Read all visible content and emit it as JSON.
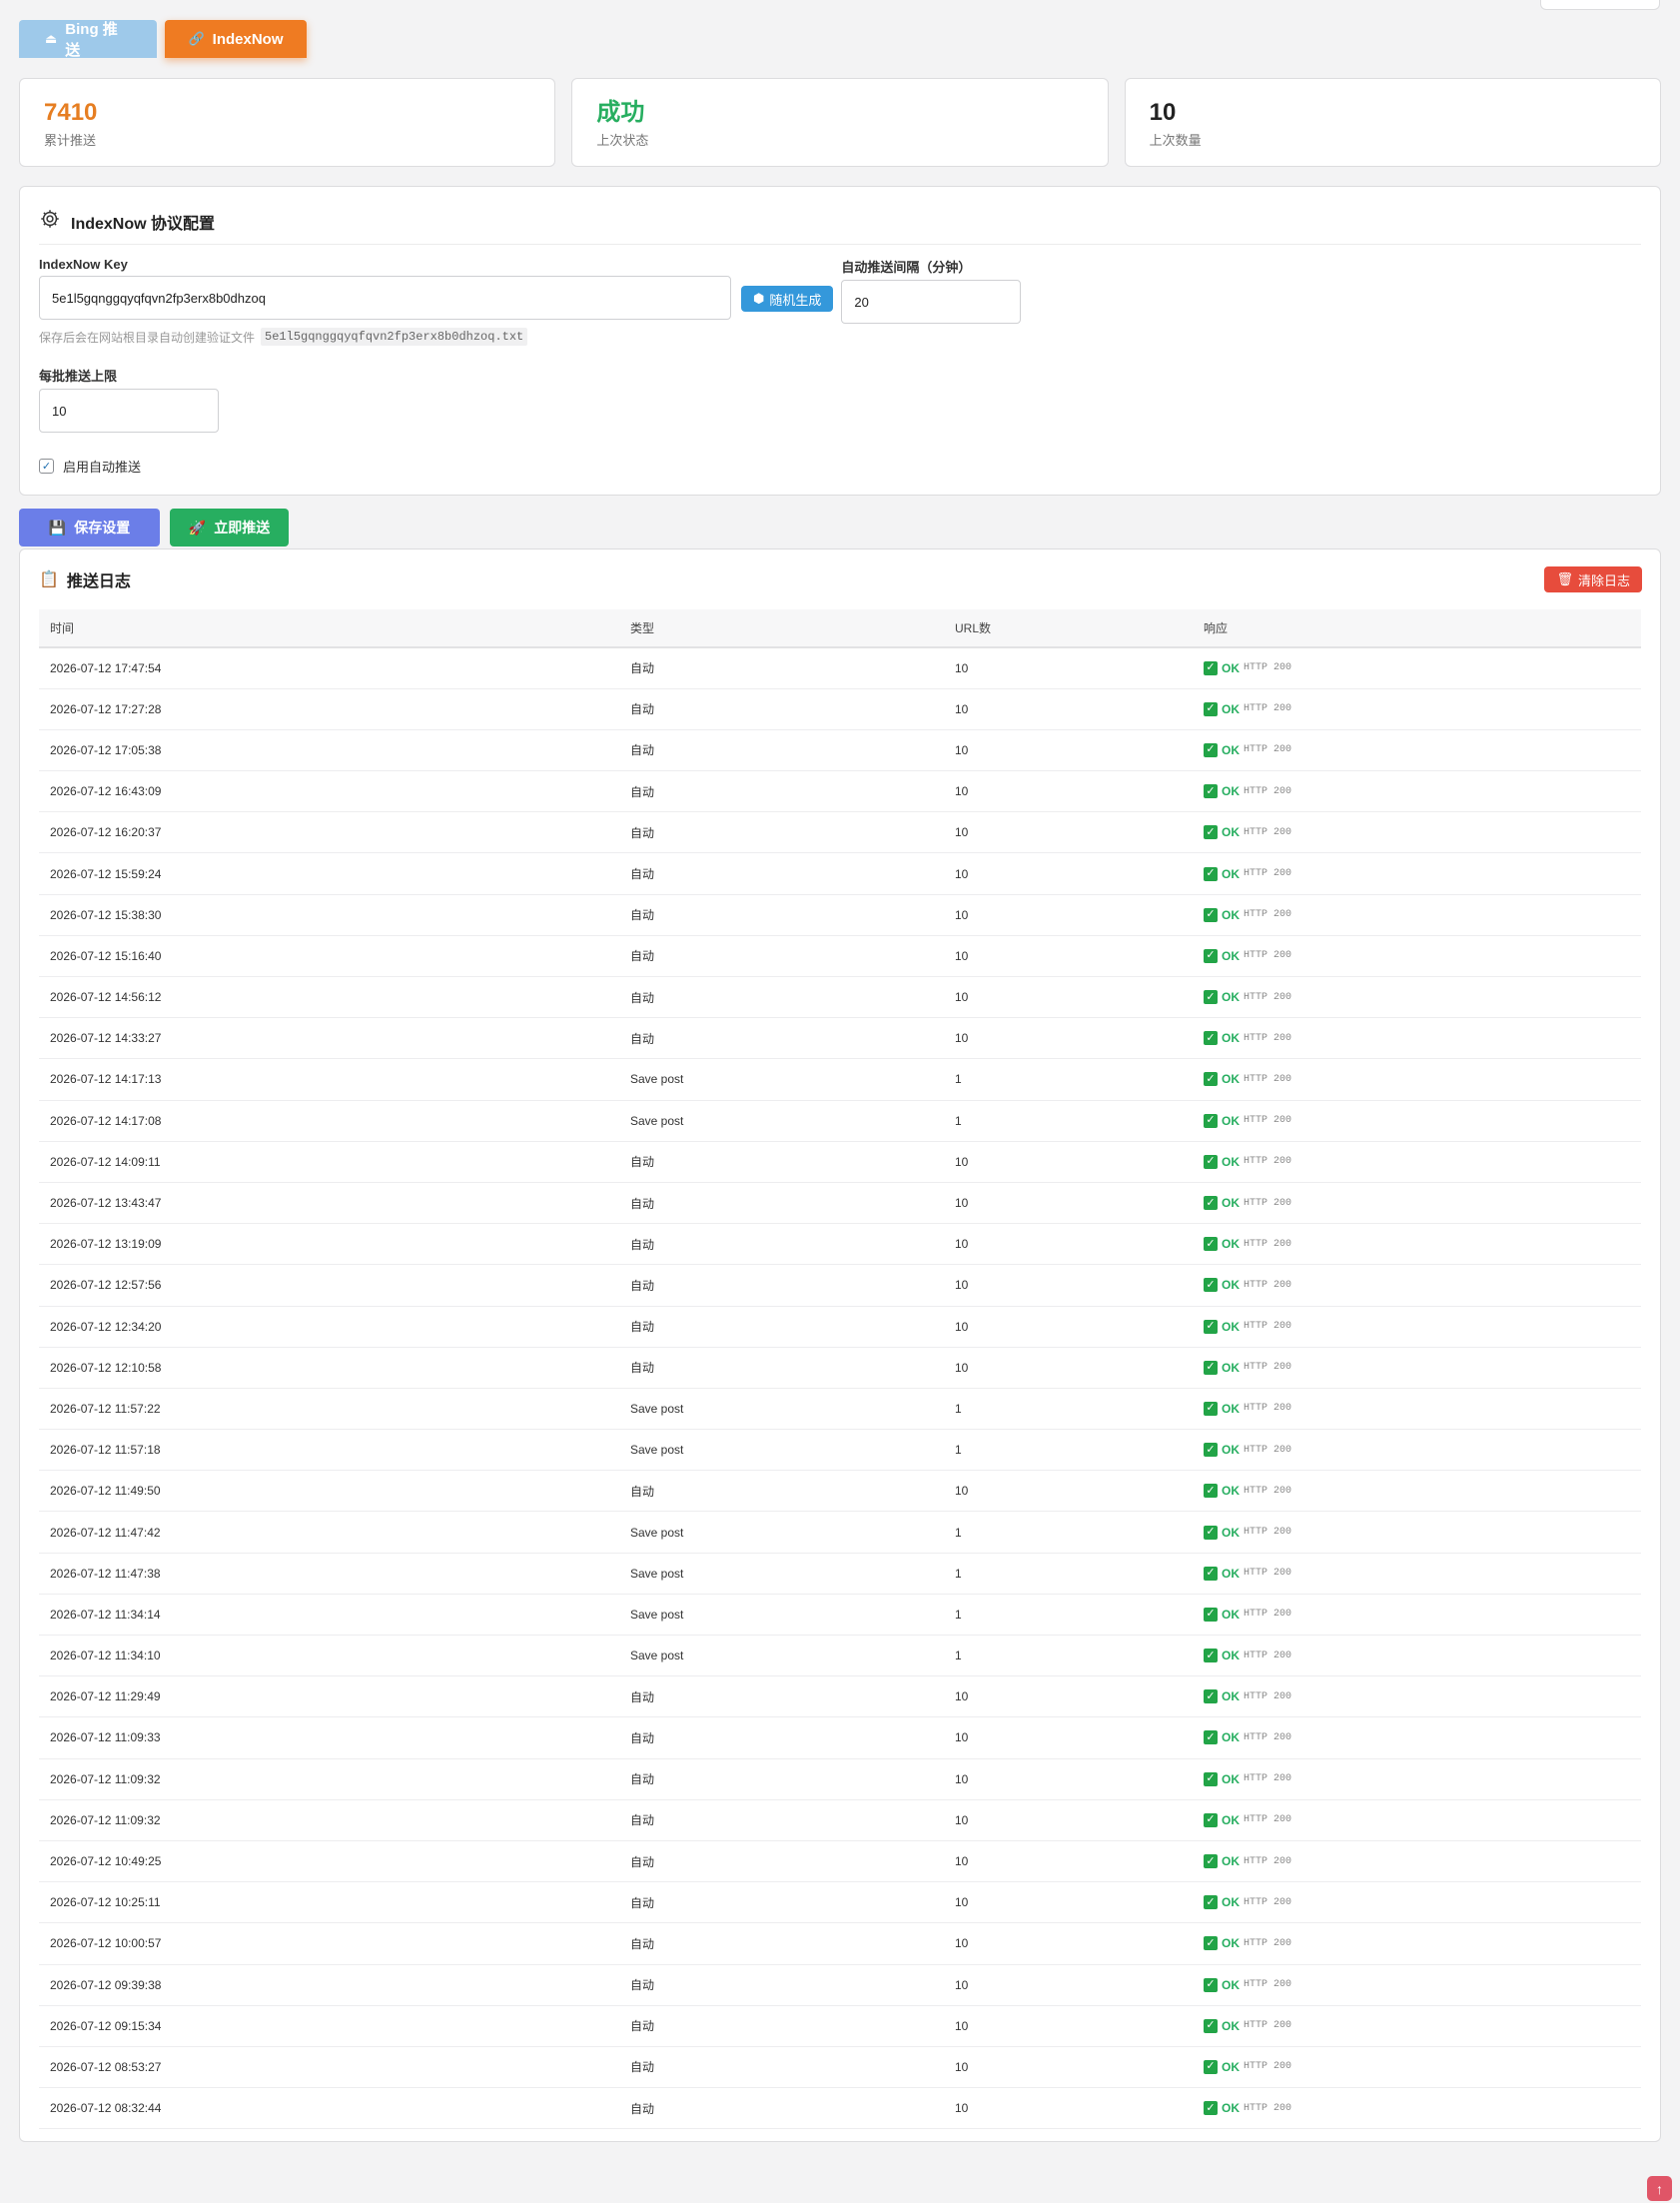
{
  "tabs": [
    {
      "label": "Bing 推送",
      "icon": "upload-icon"
    },
    {
      "label": "IndexNow",
      "icon": "link-icon"
    }
  ],
  "stats": [
    {
      "value": "7410",
      "label": "累计推送",
      "color": "#e67e22"
    },
    {
      "value": "成功",
      "label": "上次状态",
      "color": "#27ae60"
    },
    {
      "value": "10",
      "label": "上次数量",
      "color": "#222222"
    }
  ],
  "config": {
    "title": "IndexNow 协议配置",
    "key_label": "IndexNow Key",
    "key_value": "5e1l5gqnggqyqfqvn2fp3erx8b0dhzoq",
    "generate_label": "随机生成",
    "hint_text": "保存后会在网站根目录自动创建验证文件",
    "hint_file": "5e1l5gqnggqyqfqvn2fp3erx8b0dhzoq.txt",
    "interval_label": "自动推送间隔（分钟）",
    "interval_value": "20",
    "batch_label": "每批推送上限",
    "batch_value": "10",
    "auto_label": "启用自动推送",
    "auto_checked": true
  },
  "actions": {
    "save_label": "保存设置",
    "push_label": "立即推送"
  },
  "log": {
    "title": "推送日志",
    "clear_label": "清除日志",
    "columns": [
      "时间",
      "类型",
      "URL数",
      "响应"
    ],
    "ok_text": "OK",
    "http_text": "HTTP 200",
    "rows": [
      [
        "2026-07-12 17:47:54",
        "自动",
        "10"
      ],
      [
        "2026-07-12 17:27:28",
        "自动",
        "10"
      ],
      [
        "2026-07-12 17:05:38",
        "自动",
        "10"
      ],
      [
        "2026-07-12 16:43:09",
        "自动",
        "10"
      ],
      [
        "2026-07-12 16:20:37",
        "自动",
        "10"
      ],
      [
        "2026-07-12 15:59:24",
        "自动",
        "10"
      ],
      [
        "2026-07-12 15:38:30",
        "自动",
        "10"
      ],
      [
        "2026-07-12 15:16:40",
        "自动",
        "10"
      ],
      [
        "2026-07-12 14:56:12",
        "自动",
        "10"
      ],
      [
        "2026-07-12 14:33:27",
        "自动",
        "10"
      ],
      [
        "2026-07-12 14:17:13",
        "Save post",
        "1"
      ],
      [
        "2026-07-12 14:17:08",
        "Save post",
        "1"
      ],
      [
        "2026-07-12 14:09:11",
        "自动",
        "10"
      ],
      [
        "2026-07-12 13:43:47",
        "自动",
        "10"
      ],
      [
        "2026-07-12 13:19:09",
        "自动",
        "10"
      ],
      [
        "2026-07-12 12:57:56",
        "自动",
        "10"
      ],
      [
        "2026-07-12 12:34:20",
        "自动",
        "10"
      ],
      [
        "2026-07-12 12:10:58",
        "自动",
        "10"
      ],
      [
        "2026-07-12 11:57:22",
        "Save post",
        "1"
      ],
      [
        "2026-07-12 11:57:18",
        "Save post",
        "1"
      ],
      [
        "2026-07-12 11:49:50",
        "自动",
        "10"
      ],
      [
        "2026-07-12 11:47:42",
        "Save post",
        "1"
      ],
      [
        "2026-07-12 11:47:38",
        "Save post",
        "1"
      ],
      [
        "2026-07-12 11:34:14",
        "Save post",
        "1"
      ],
      [
        "2026-07-12 11:34:10",
        "Save post",
        "1"
      ],
      [
        "2026-07-12 11:29:49",
        "自动",
        "10"
      ],
      [
        "2026-07-12 11:09:33",
        "自动",
        "10"
      ],
      [
        "2026-07-12 11:09:32",
        "自动",
        "10"
      ],
      [
        "2026-07-12 11:09:32",
        "自动",
        "10"
      ],
      [
        "2026-07-12 10:49:25",
        "自动",
        "10"
      ],
      [
        "2026-07-12 10:25:11",
        "自动",
        "10"
      ],
      [
        "2026-07-12 10:00:57",
        "自动",
        "10"
      ],
      [
        "2026-07-12 09:39:38",
        "自动",
        "10"
      ],
      [
        "2026-07-12 09:15:34",
        "自动",
        "10"
      ],
      [
        "2026-07-12 08:53:27",
        "自动",
        "10"
      ],
      [
        "2026-07-12 08:32:44",
        "自动",
        "10"
      ]
    ]
  },
  "back_to_top": "↑"
}
